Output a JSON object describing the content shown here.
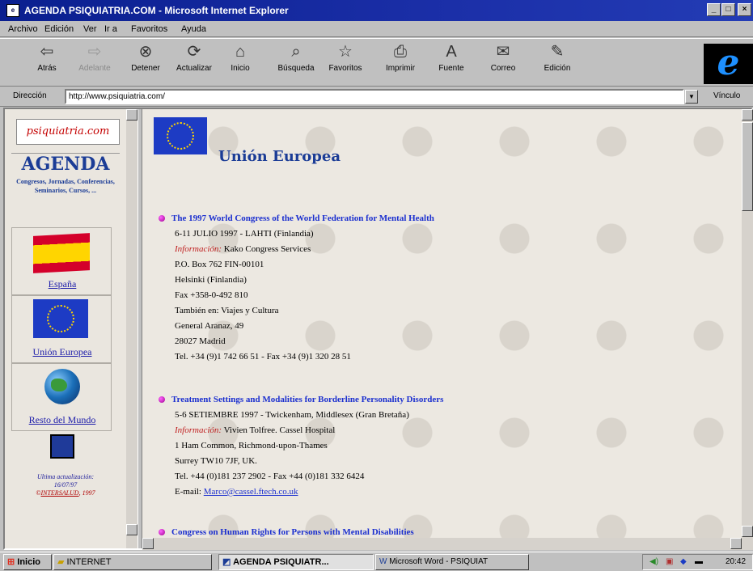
{
  "window": {
    "title": "AGENDA PSIQUIATRIA.COM - Microsoft Internet Explorer",
    "icon": "ie-page-icon",
    "controls": {
      "minimize": "_",
      "maximize": "□",
      "close": "×"
    }
  },
  "menubar": {
    "items": [
      "Archivo",
      "Edición",
      "Ver",
      "Ir a",
      "Favoritos",
      "Ayuda"
    ]
  },
  "toolbar": {
    "buttons": [
      {
        "label": "Atrás",
        "icon": "back-arrow-icon",
        "glyph": "⇦",
        "enabled": true
      },
      {
        "label": "Adelante",
        "icon": "forward-arrow-icon",
        "glyph": "⇨",
        "enabled": false
      },
      {
        "label": "Detener",
        "icon": "stop-icon",
        "glyph": "⊗",
        "enabled": true
      },
      {
        "label": "Actualizar",
        "icon": "refresh-icon",
        "glyph": "⟳",
        "enabled": true
      },
      {
        "label": "Inicio",
        "icon": "home-icon",
        "glyph": "⌂",
        "enabled": true
      },
      {
        "label": "Búsqueda",
        "icon": "search-icon",
        "glyph": "⌕",
        "enabled": true
      },
      {
        "label": "Favoritos",
        "icon": "favorites-icon",
        "glyph": "☆",
        "enabled": true
      },
      {
        "label": "Imprimir",
        "icon": "print-icon",
        "glyph": "⎙",
        "enabled": true
      },
      {
        "label": "Fuente",
        "icon": "font-icon",
        "glyph": "A",
        "enabled": true
      },
      {
        "label": "Correo",
        "icon": "mail-icon",
        "glyph": "✉",
        "enabled": true
      },
      {
        "label": "Edición",
        "icon": "edit-icon",
        "glyph": "✎",
        "enabled": true
      }
    ]
  },
  "address": {
    "label": "Dirección",
    "url": "http://www.psiquiatria.com/",
    "links": "Vínculo"
  },
  "left_frame": {
    "logo": "psiquiatria.com",
    "title": "AGENDA",
    "subtitle": "Congresos, Jornadas, Conferencias, Seminarios, Cursos, ...",
    "nav": [
      {
        "label": "España",
        "icon": "spain-flag"
      },
      {
        "label": "Unión Europea",
        "icon": "eu-flag"
      },
      {
        "label": "Resto del Mundo",
        "icon": "globe-icon"
      }
    ],
    "update_label": "Ultima actualización:",
    "update_date": "16/07/97",
    "copyright_symbol": "©",
    "copyright_org": "INTERSALUD",
    "copyright_year": "1997"
  },
  "main": {
    "heading": "Unión Europea",
    "entries": [
      {
        "title": "The 1997 World Congress of the World Federation for Mental Health",
        "date": "6-11 JULIO 1997 - LAHTI (Finlandia)",
        "info_label": "Información:",
        "info_value": "Kako Congress Services",
        "lines": [
          "P.O. Box 762 FIN-00101",
          "Helsinki (Finlandia)",
          "Fax +358-0-492 810",
          "También en: Viajes y Cultura",
          "General Aranaz, 49",
          "28027 Madrid",
          "Tel. +34 (9)1 742 66 51 - Fax +34 (9)1 320 28 51"
        ]
      },
      {
        "title": "Treatment Settings and Modalities for Borderline Personality Disorders",
        "date": "5-6 SETIEMBRE 1997 - Twickenham, Middlesex (Gran Bretaña)",
        "info_label": "Información:",
        "info_value": "Vivien Tolfree. Cassel Hospital",
        "lines": [
          "1 Ham Common, Richmond-upon-Thames",
          "Surrey TW10 7JF, UK.",
          "Tel. +44 (0)181 237 2902 - Fax +44 (0)181 332 6424"
        ],
        "email_label": "E-mail:",
        "email": "Marco@cassel.ftech.co.uk"
      },
      {
        "title": "Congress on Human Rights for Persons with Mental Disabilities"
      }
    ]
  },
  "taskbar": {
    "start": "Inicio",
    "items": [
      {
        "label": "INTERNET",
        "icon": "folder-icon"
      },
      {
        "label": "AGENDA PSIQUIATR...",
        "icon": "ie-page-icon",
        "active": true
      },
      {
        "label": "Microsoft Word - PSIQUIAT",
        "icon": "word-icon"
      }
    ],
    "clock": "20:42"
  }
}
